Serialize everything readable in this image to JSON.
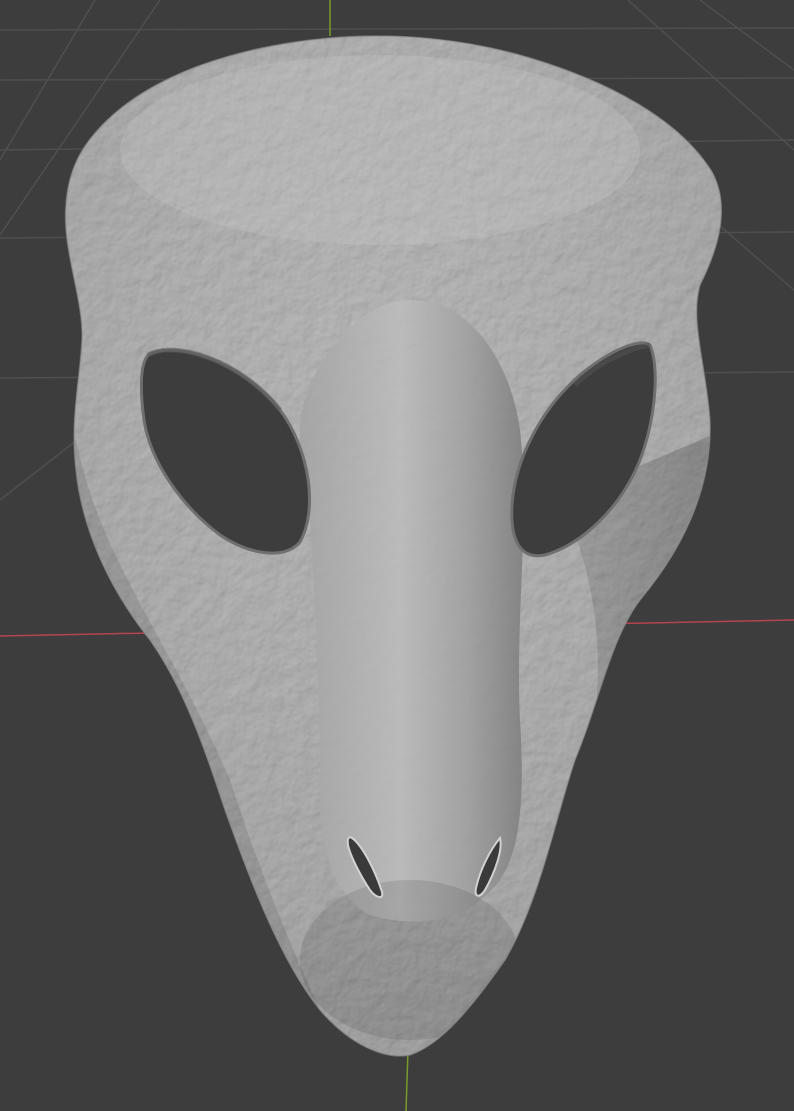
{
  "viewport": {
    "background": "#3d3d3d",
    "grid_color": "#4e4e4e",
    "x_axis_color": "#b2444d",
    "y_axis_color": "#789b2a"
  },
  "mesh": {
    "object": "reptile-skull-mask",
    "base_color": "#a9a9a9",
    "highlight_color": "#c4c4c4",
    "shadow_color": "#6d6d6d",
    "shading": "solid",
    "surface_detail": "scaly bumps"
  }
}
